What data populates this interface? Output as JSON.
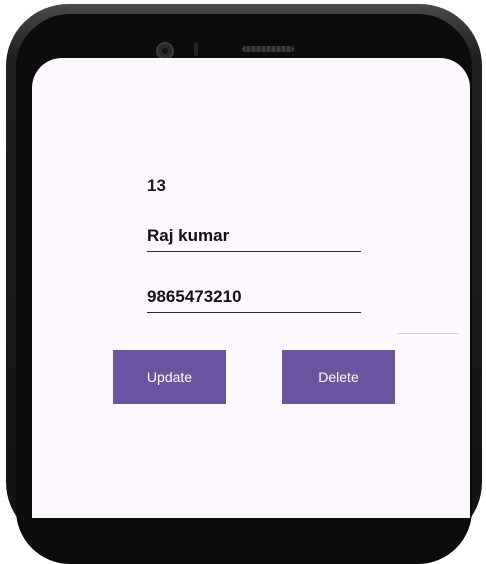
{
  "record": {
    "id": "13",
    "name": "Raj kumar",
    "phone": "9865473210"
  },
  "buttons": {
    "update": "Update",
    "delete": "Delete"
  },
  "colors": {
    "button": "#6a539f",
    "screen_background": "#fdf8fd",
    "phone_frame": "#1a1a1a"
  },
  "icons": [
    "front-camera-icon",
    "speaker-grille-icon"
  ]
}
